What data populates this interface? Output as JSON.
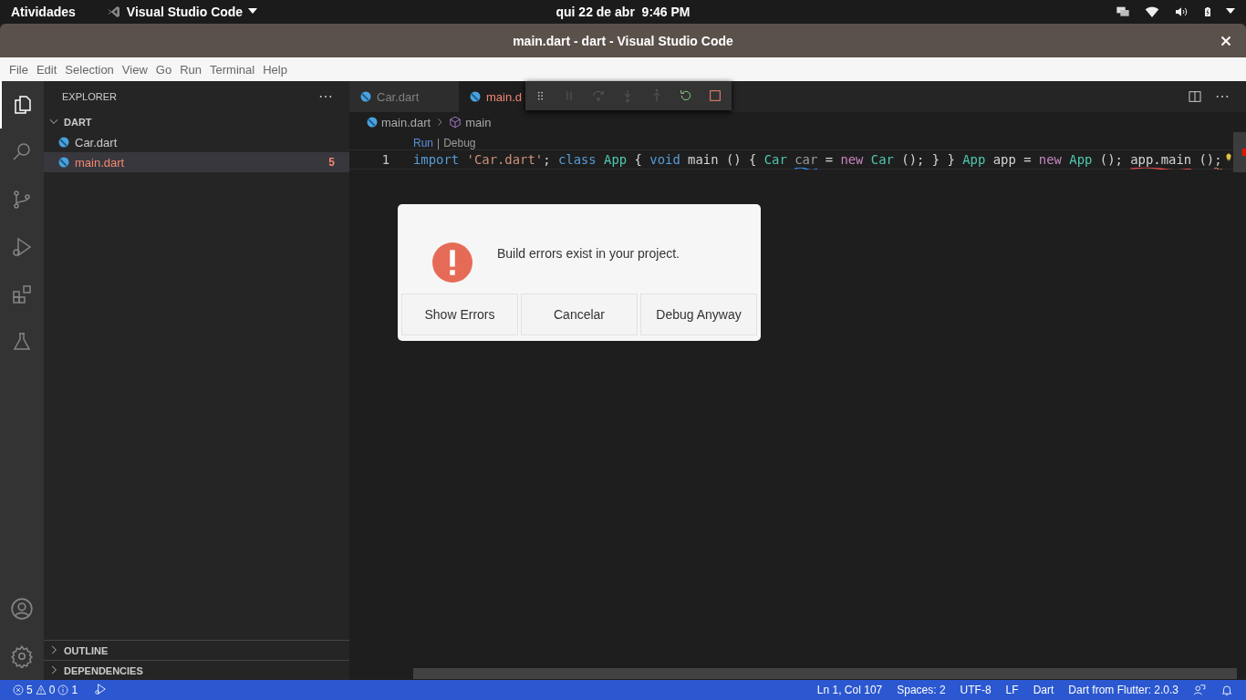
{
  "top_bar": {
    "activities": "Atividades",
    "app_name": "Visual Studio Code",
    "clock": "qui 22 de abr  9:46 PM"
  },
  "window": {
    "title": "main.dart - dart - Visual Studio Code"
  },
  "menu": [
    "File",
    "Edit",
    "Selection",
    "View",
    "Go",
    "Run",
    "Terminal",
    "Help"
  ],
  "activity_bar": {
    "top": [
      {
        "kind": "explorer",
        "selected": true
      },
      {
        "kind": "search",
        "selected": false
      },
      {
        "kind": "source-control",
        "selected": false
      },
      {
        "kind": "run-debug",
        "selected": false
      },
      {
        "kind": "extensions",
        "selected": false
      },
      {
        "kind": "testing",
        "selected": false
      }
    ],
    "bottom": [
      {
        "kind": "account"
      },
      {
        "kind": "settings"
      }
    ]
  },
  "sidebar": {
    "title": "EXPLORER",
    "folder": {
      "name": "DART",
      "expanded": true,
      "files": [
        {
          "name": "Car.dart",
          "selected": false,
          "error": false
        },
        {
          "name": "main.dart",
          "selected": true,
          "error": true,
          "badge": "5"
        }
      ]
    },
    "sections": [
      {
        "name": "OUTLINE",
        "expanded": false
      },
      {
        "name": "DEPENDENCIES",
        "expanded": false
      }
    ]
  },
  "tabs": [
    {
      "label": "Car.dart",
      "selected": false,
      "error": false
    },
    {
      "label": "main.d",
      "selected": true,
      "error": true
    }
  ],
  "debug_toolbar": [
    {
      "kind": "grip",
      "disabled": false
    },
    {
      "kind": "pause",
      "disabled": true
    },
    {
      "kind": "step-over",
      "disabled": true
    },
    {
      "kind": "step-into",
      "disabled": true
    },
    {
      "kind": "step-out",
      "disabled": true
    },
    {
      "kind": "restart",
      "disabled": false
    },
    {
      "kind": "stop",
      "disabled": false
    }
  ],
  "breadcrumb": [
    "main.dart",
    "main"
  ],
  "code_lens": {
    "items": [
      "Run",
      "Debug"
    ],
    "separator": "|"
  },
  "code": {
    "line_number": "1",
    "tokens": [
      {
        "text": "import",
        "kind": "keyword"
      },
      {
        "text": " 'Car.dart'",
        "kind": "string"
      },
      {
        "text": "; ",
        "kind": "plain"
      },
      {
        "text": "class",
        "kind": "keyword"
      },
      {
        "text": " App",
        "kind": "type"
      },
      {
        "text": " { ",
        "kind": "plain"
      },
      {
        "text": "void",
        "kind": "keyword"
      },
      {
        "text": " main () { ",
        "kind": "plain"
      },
      {
        "text": "Car ",
        "kind": "type"
      },
      {
        "text": "car",
        "kind": "unused",
        "info": true
      },
      {
        "text": " = ",
        "kind": "plain"
      },
      {
        "text": "new",
        "kind": "control"
      },
      {
        "text": " Car",
        "kind": "type"
      },
      {
        "text": " (); } } ",
        "kind": "plain"
      },
      {
        "text": "App",
        "kind": "type"
      },
      {
        "text": " app = ",
        "kind": "plain"
      },
      {
        "text": "new",
        "kind": "control"
      },
      {
        "text": " App",
        "kind": "type"
      },
      {
        "text": " (); ",
        "kind": "plain"
      },
      {
        "text": "app.main",
        "kind": "plain",
        "error": true
      },
      {
        "text": " ()",
        "kind": "plain"
      },
      {
        "text": ";",
        "kind": "plain",
        "warning": true
      }
    ]
  },
  "dialog": {
    "message": "Build errors exist in your project.",
    "buttons": [
      "Show Errors",
      "Cancelar",
      "Debug Anyway"
    ]
  },
  "status_bar": {
    "errors": "5",
    "warnings": "0",
    "infos": "1",
    "items": [
      "Ln 1, Col 107",
      "Spaces: 2",
      "UTF-8",
      "LF",
      "Dart",
      "Dart from Flutter: 2.0.3"
    ]
  }
}
